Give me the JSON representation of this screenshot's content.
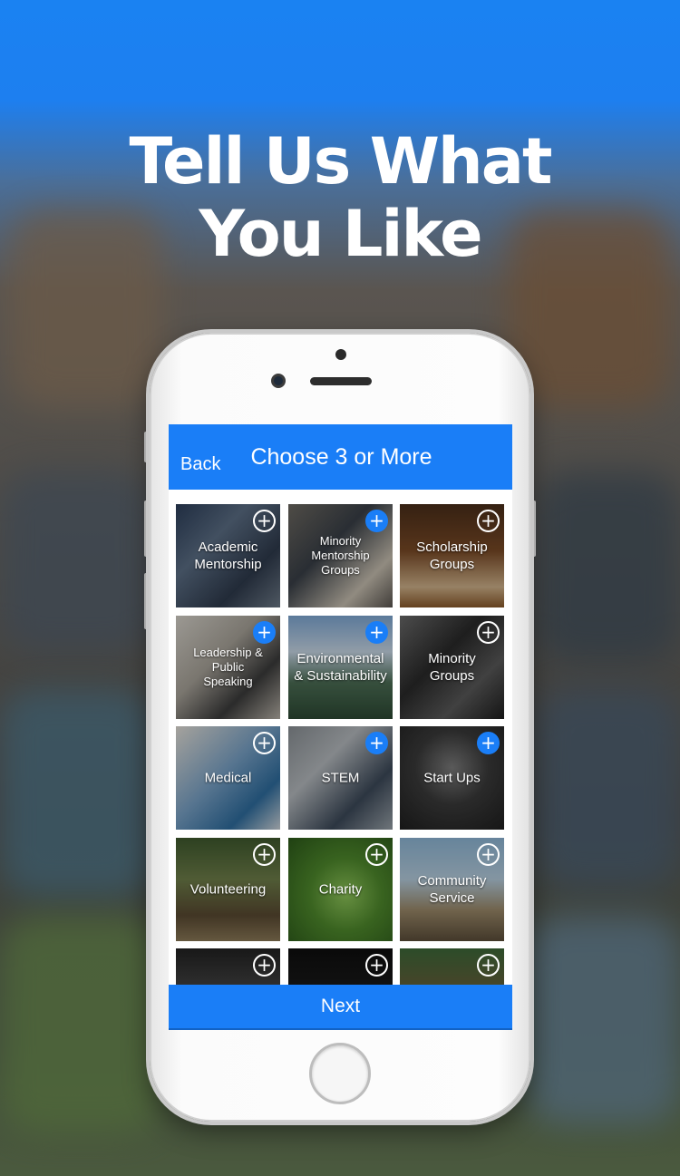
{
  "promo": {
    "headline_line1": "Tell Us What",
    "headline_line2": "You Like"
  },
  "navbar": {
    "back_label": "Back",
    "title": "Choose 3 or More"
  },
  "categories": [
    {
      "label": "Academic\nMentorship",
      "selected": false,
      "icon": "plus-circle-icon"
    },
    {
      "label": "Minority\nMentorship\nGroups",
      "selected": true,
      "icon": "plus-circle-icon"
    },
    {
      "label": "Scholarship\nGroups",
      "selected": false,
      "icon": "plus-circle-icon"
    },
    {
      "label": "Leadership &\nPublic\nSpeaking",
      "selected": true,
      "icon": "plus-circle-icon"
    },
    {
      "label": "Environmental\n& Sustainability",
      "selected": true,
      "icon": "plus-circle-icon"
    },
    {
      "label": "Minority\nGroups",
      "selected": false,
      "icon": "plus-circle-icon"
    },
    {
      "label": "Medical",
      "selected": false,
      "icon": "plus-circle-icon"
    },
    {
      "label": "STEM",
      "selected": true,
      "icon": "plus-circle-icon"
    },
    {
      "label": "Start Ups",
      "selected": true,
      "icon": "plus-circle-icon"
    },
    {
      "label": "Volunteering",
      "selected": false,
      "icon": "plus-circle-icon"
    },
    {
      "label": "Charity",
      "selected": false,
      "icon": "plus-circle-icon"
    },
    {
      "label": "Community\nService",
      "selected": false,
      "icon": "plus-circle-icon"
    },
    {
      "label": "",
      "selected": false,
      "icon": "plus-circle-icon"
    },
    {
      "label": "",
      "selected": false,
      "icon": "plus-circle-icon"
    },
    {
      "label": "",
      "selected": false,
      "icon": "plus-circle-icon"
    }
  ],
  "footer": {
    "next_label": "Next"
  },
  "colors": {
    "accent": "#1a7ef7",
    "navbar_text": "#ffffff"
  }
}
